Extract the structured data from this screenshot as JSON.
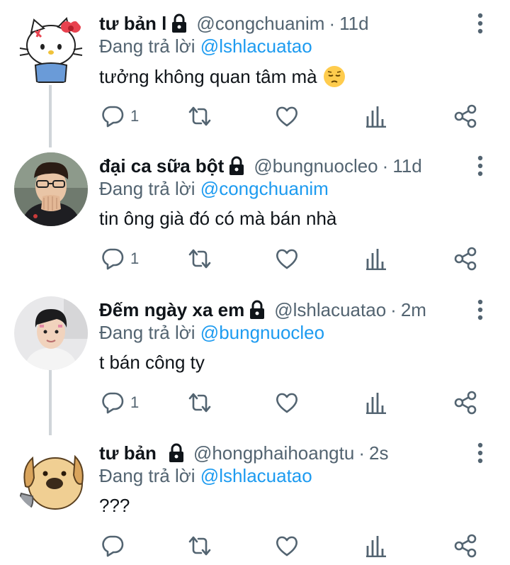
{
  "tweets": [
    {
      "display_name": "tư bản l",
      "handle": "@congchuanim",
      "separator": "·",
      "time": "11d",
      "reply_prefix": "Đang trả lời",
      "reply_to": "@lshlacuatao",
      "text": "tưởng không quan tâm mà",
      "emoji": "pensive-face",
      "reply_count": "1",
      "avatar": "hello-kitty-avatar"
    },
    {
      "display_name": "đại ca sữa bột",
      "handle": "@bungnuocleo",
      "separator": "·",
      "time": "11d",
      "reply_prefix": "Đang trả lời",
      "reply_to": "@congchuanim",
      "text": "tin ông già đó có mà bán nhà",
      "reply_count": "1",
      "avatar": "person-glasses-avatar"
    },
    {
      "display_name": "Đếm ngày xa em",
      "handle": "@lshlacuatao",
      "separator": "·",
      "time": "2m",
      "reply_prefix": "Đang trả lời",
      "reply_to": "@bungnuocleo",
      "text": "t bán công ty",
      "reply_count": "1",
      "avatar": "person-avatar"
    },
    {
      "display_name": "tư bản",
      "handle": "@hongphaihoangtu",
      "separator": "·",
      "time": "2s",
      "reply_prefix": "Đang trả lời",
      "reply_to": "@lshlacuatao",
      "text": "???",
      "reply_count": "",
      "avatar": "dog-avatar"
    }
  ],
  "colors": {
    "text": "#0f1419",
    "secondary": "#536471",
    "mention": "#1d9bf0",
    "thread_line": "#d0d5d9"
  },
  "icons": [
    "reply-icon",
    "retweet-icon",
    "like-icon",
    "analytics-icon",
    "share-icon",
    "more-icon",
    "lock-icon"
  ]
}
